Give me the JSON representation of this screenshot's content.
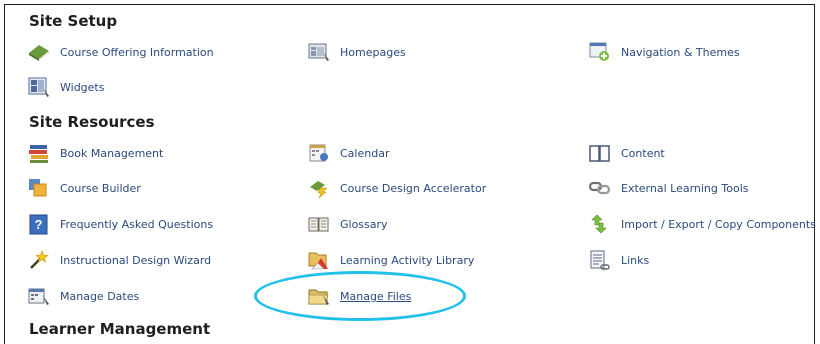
{
  "sections": {
    "site_setup": "Site Setup",
    "site_resources": "Site Resources",
    "learner_management": "Learner Management"
  },
  "tools": {
    "course_offering_information": "Course Offering Information",
    "homepages": "Homepages",
    "navigation_themes": "Navigation & Themes",
    "widgets": "Widgets",
    "book_management": "Book Management",
    "calendar": "Calendar",
    "content": "Content",
    "course_builder": "Course Builder",
    "course_design_accelerator": "Course Design Accelerator",
    "external_learning_tools": "External Learning Tools",
    "frequently_asked_questions": "Frequently Asked Questions",
    "glossary": "Glossary",
    "import_export_copy_components": "Import / Export / Copy Components",
    "instructional_design_wizard": "Instructional Design Wizard",
    "learning_activity_library": "Learning Activity Library",
    "links": "Links",
    "manage_dates": "Manage Dates",
    "manage_files": "Manage Files"
  },
  "highlighted_tool": "manage_files",
  "colors": {
    "link": "#2b4a7e",
    "heading": "#1f1f1f",
    "highlight": "#22c1e8"
  }
}
